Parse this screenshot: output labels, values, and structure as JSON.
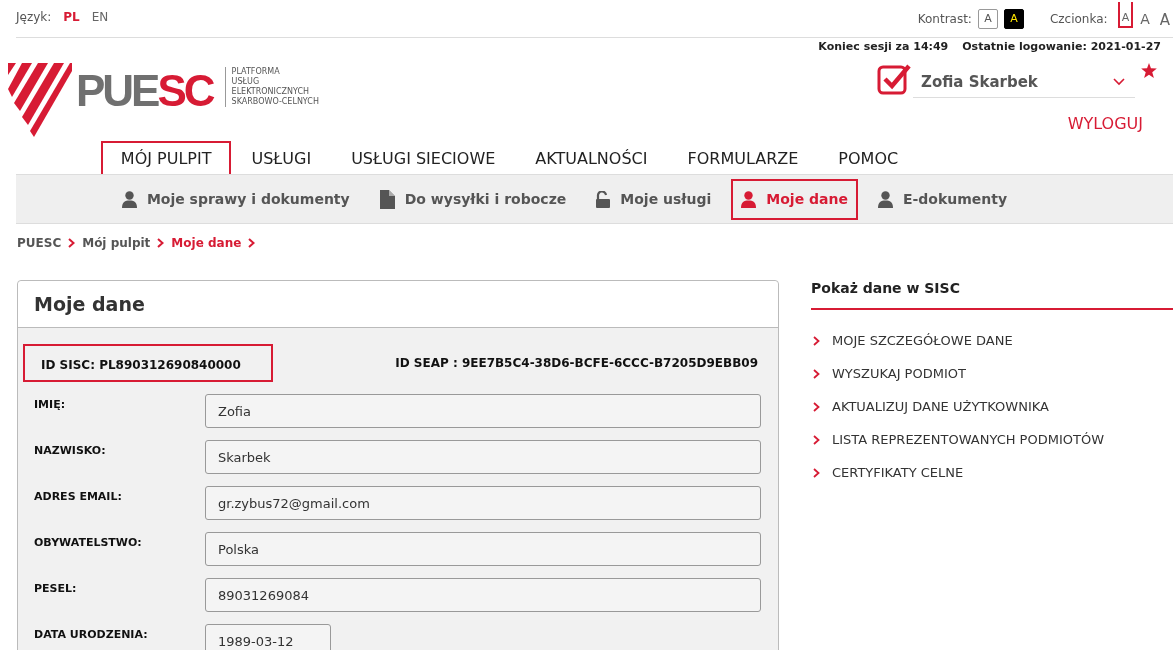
{
  "top_bar": {
    "language_label": "Język:",
    "languages": [
      {
        "code": "PL",
        "selected": true
      },
      {
        "code": "EN",
        "selected": false
      }
    ],
    "contrast_label": "Kontrast:",
    "contrast_options": [
      {
        "label": "A",
        "kind": "normal"
      },
      {
        "label": "A",
        "kind": "high"
      }
    ],
    "font_label": "Czcionka:",
    "font_sizes": [
      {
        "label": "A",
        "selected": true
      },
      {
        "label": "A",
        "selected": false
      },
      {
        "label": "A",
        "selected": false
      }
    ]
  },
  "session": {
    "timeout": "Koniec sesji za 14:49",
    "last_login": "Ostatnie logowanie: 2021-01-27"
  },
  "logo": {
    "word_grey": "PUE",
    "word_red": "SC",
    "tagline": [
      "PLATFORMA",
      "USŁUG",
      "ELEKTRONICZNYCH",
      "SKARBOWO-CELNYCH"
    ]
  },
  "user": {
    "name": "Zofia Skarbek",
    "logout": "WYLOGUJ"
  },
  "main_nav": [
    {
      "label": "MÓJ PULPIT",
      "selected": true
    },
    {
      "label": "USŁUGI",
      "selected": false
    },
    {
      "label": "USŁUGI SIECIOWE",
      "selected": false
    },
    {
      "label": "AKTUALNOŚCI",
      "selected": false
    },
    {
      "label": "FORMULARZE",
      "selected": false
    },
    {
      "label": "POMOC",
      "selected": false
    }
  ],
  "sub_nav": [
    {
      "label": "Moje sprawy i dokumenty",
      "kind": "person",
      "selected": false
    },
    {
      "label": "Do wysyłki i robocze",
      "kind": "file",
      "selected": false
    },
    {
      "label": "Moje usługi",
      "kind": "lock",
      "selected": false
    },
    {
      "label": "Moje dane",
      "kind": "person",
      "selected": true
    },
    {
      "label": "E-dokumenty",
      "kind": "person",
      "selected": false
    }
  ],
  "breadcrumb": [
    {
      "label": "PUESC",
      "selected": false
    },
    {
      "label": "Mój pulpit",
      "selected": false
    },
    {
      "label": "Moje dane",
      "selected": true
    }
  ],
  "card": {
    "title": "Moje dane",
    "id_sisc": "ID SISC: PL890312690840000",
    "id_seap": "ID SEAP : 9EE7B5C4-38D6-BCFE-6CCC-B7205D9EBB09",
    "fields": [
      {
        "label": "IMIĘ:",
        "value": "Zofia",
        "kind": "wide"
      },
      {
        "label": "NAZWISKO:",
        "value": "Skarbek",
        "kind": "wide"
      },
      {
        "label": "ADRES EMAIL:",
        "value": "gr.zybus72@gmail.com",
        "kind": "wide"
      },
      {
        "label": "OBYWATELSTWO:",
        "value": "Polska",
        "kind": "wide"
      },
      {
        "label": "PESEL:",
        "value": "89031269084",
        "kind": "wide"
      },
      {
        "label": "DATA URODZENIA:",
        "value": "1989-03-12",
        "kind": "short"
      }
    ]
  },
  "side_panel": {
    "title": "Pokaż dane w SISC",
    "links": [
      "MOJE SZCZEGÓŁOWE DANE",
      "WYSZUKAJ PODMIOT",
      "AKTUALIZUJ DANE UŻYTKOWNIKA",
      "LISTA REPREZENTOWANYCH PODMIOTÓW",
      "CERTYFIKATY CELNE"
    ]
  }
}
